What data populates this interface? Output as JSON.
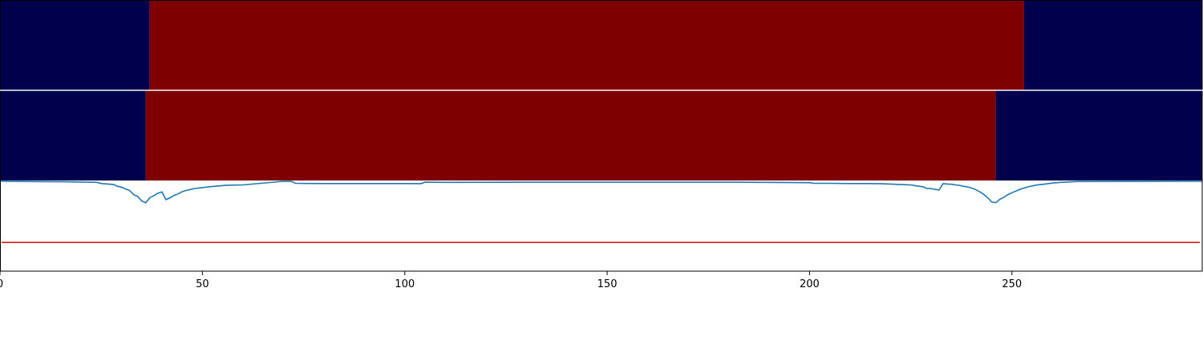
{
  "chart_data": {
    "type": "line",
    "description_layout": "two segmentation bands above a line plot",
    "x_range": [
      0,
      297
    ],
    "x_ticks": [
      0,
      50,
      100,
      150,
      200,
      250
    ],
    "band_rows": [
      {
        "segments": [
          {
            "start": 0,
            "end": 37,
            "class": "low",
            "color": "#00004c"
          },
          {
            "start": 37,
            "end": 253,
            "class": "high",
            "color": "#7f0000"
          },
          {
            "start": 253,
            "end": 297,
            "class": "low",
            "color": "#00004c"
          }
        ]
      },
      {
        "segments": [
          {
            "start": 0,
            "end": 36,
            "class": "low",
            "color": "#00004c"
          },
          {
            "start": 36,
            "end": 246,
            "class": "high",
            "color": "#7f0000"
          },
          {
            "start": 246,
            "end": 297,
            "class": "low",
            "color": "#00004c"
          }
        ]
      }
    ],
    "line_panel": {
      "y_range": [
        -0.5,
        0.5
      ],
      "threshold": {
        "y": -0.18,
        "color": "#e31a1c"
      },
      "series": [
        {
          "color": "#1f77b4",
          "x": [
            0,
            8,
            16,
            20,
            22,
            24,
            25,
            27,
            28,
            29,
            30,
            31,
            32,
            33,
            34,
            35,
            36,
            37,
            38,
            39,
            40,
            41,
            42,
            43,
            44,
            45,
            46,
            47,
            48,
            50,
            52,
            54,
            56,
            60,
            70,
            72,
            73,
            76,
            80,
            90,
            100,
            104,
            105,
            110,
            130,
            150,
            180,
            200,
            201,
            205,
            210,
            215,
            218,
            220,
            222,
            224,
            225,
            227,
            228,
            229,
            230,
            231,
            232,
            233,
            234,
            235,
            236,
            237,
            238,
            239,
            240,
            241,
            242,
            243,
            244,
            245,
            246,
            247,
            248,
            249,
            250,
            251,
            252,
            254,
            256,
            258,
            260,
            262,
            264,
            266,
            297
          ],
          "y": [
            0.5,
            0.497,
            0.495,
            0.492,
            0.49,
            0.488,
            0.475,
            0.468,
            0.465,
            0.445,
            0.435,
            0.415,
            0.398,
            0.352,
            0.332,
            0.283,
            0.262,
            0.316,
            0.34,
            0.368,
            0.382,
            0.296,
            0.316,
            0.343,
            0.36,
            0.384,
            0.398,
            0.408,
            0.42,
            0.43,
            0.44,
            0.448,
            0.456,
            0.46,
            0.5,
            0.498,
            0.478,
            0.476,
            0.475,
            0.475,
            0.475,
            0.474,
            0.49,
            0.488,
            0.49,
            0.49,
            0.49,
            0.485,
            0.478,
            0.478,
            0.475,
            0.475,
            0.472,
            0.47,
            0.465,
            0.462,
            0.46,
            0.445,
            0.44,
            0.42,
            0.42,
            0.41,
            0.403,
            0.475,
            0.47,
            0.468,
            0.46,
            0.455,
            0.445,
            0.438,
            0.425,
            0.408,
            0.385,
            0.355,
            0.318,
            0.27,
            0.262,
            0.298,
            0.322,
            0.352,
            0.372,
            0.392,
            0.412,
            0.438,
            0.458,
            0.468,
            0.48,
            0.488,
            0.493,
            0.497,
            0.5
          ]
        }
      ]
    }
  }
}
